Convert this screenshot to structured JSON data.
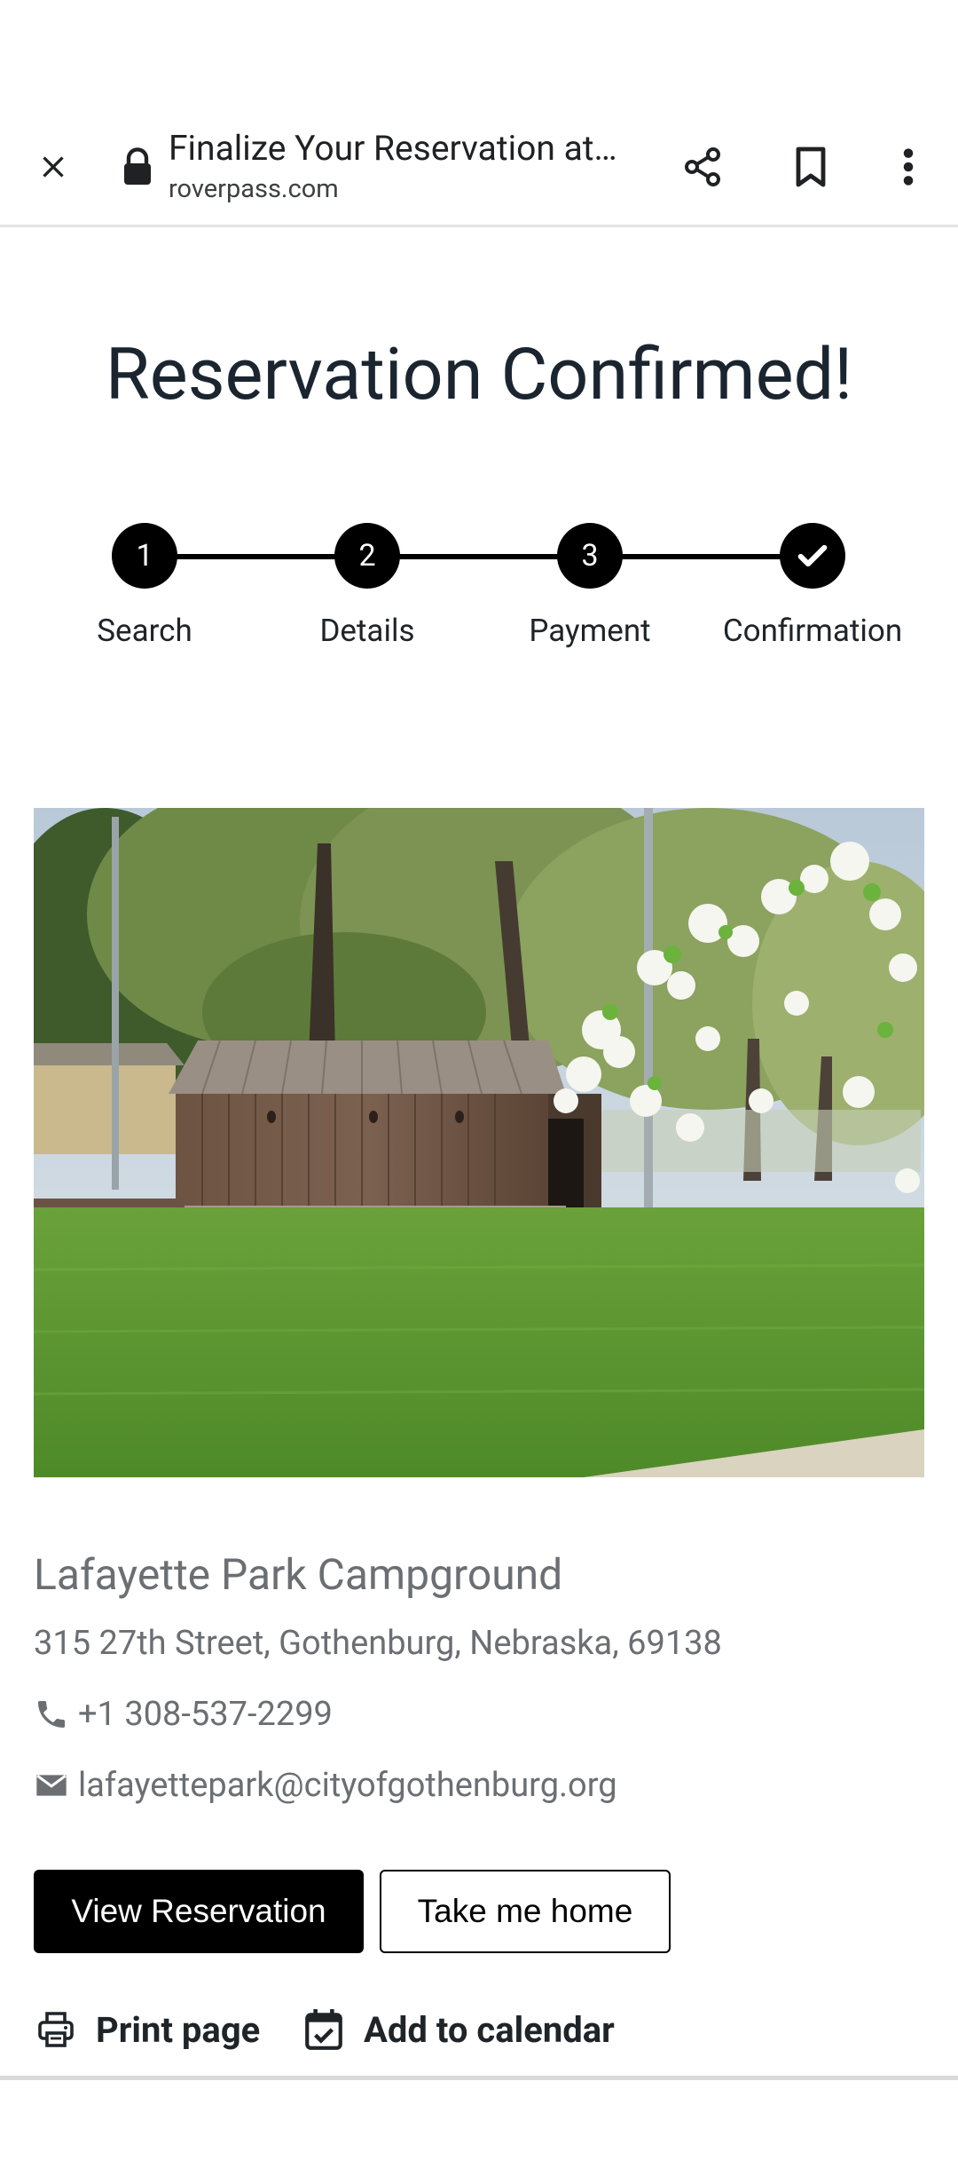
{
  "toolbar": {
    "page_title": "Finalize Your Reservation at…",
    "url": "roverpass.com"
  },
  "heading": "Reservation Confirmed!",
  "stepper": {
    "steps": [
      {
        "number": "1",
        "label": "Search"
      },
      {
        "number": "2",
        "label": "Details"
      },
      {
        "number": "3",
        "label": "Payment"
      },
      {
        "number": "",
        "label": "Confirmation"
      }
    ],
    "completed_icon": "check-icon"
  },
  "campground": {
    "name": "Lafayette Park Campground",
    "address": "315 27th Street, Gothenburg, Nebraska, 69138",
    "phone": "+1 308-537-2299",
    "email": "lafayettepark@cityofgothenburg.org"
  },
  "buttons": {
    "view_reservation": "View Reservation",
    "take_me_home": "Take me home"
  },
  "actions": {
    "print": "Print page",
    "calendar": "Add to calendar"
  },
  "colors": {
    "primary": "#000000",
    "heading": "#1b2530",
    "muted_text": "#6b6f73"
  }
}
